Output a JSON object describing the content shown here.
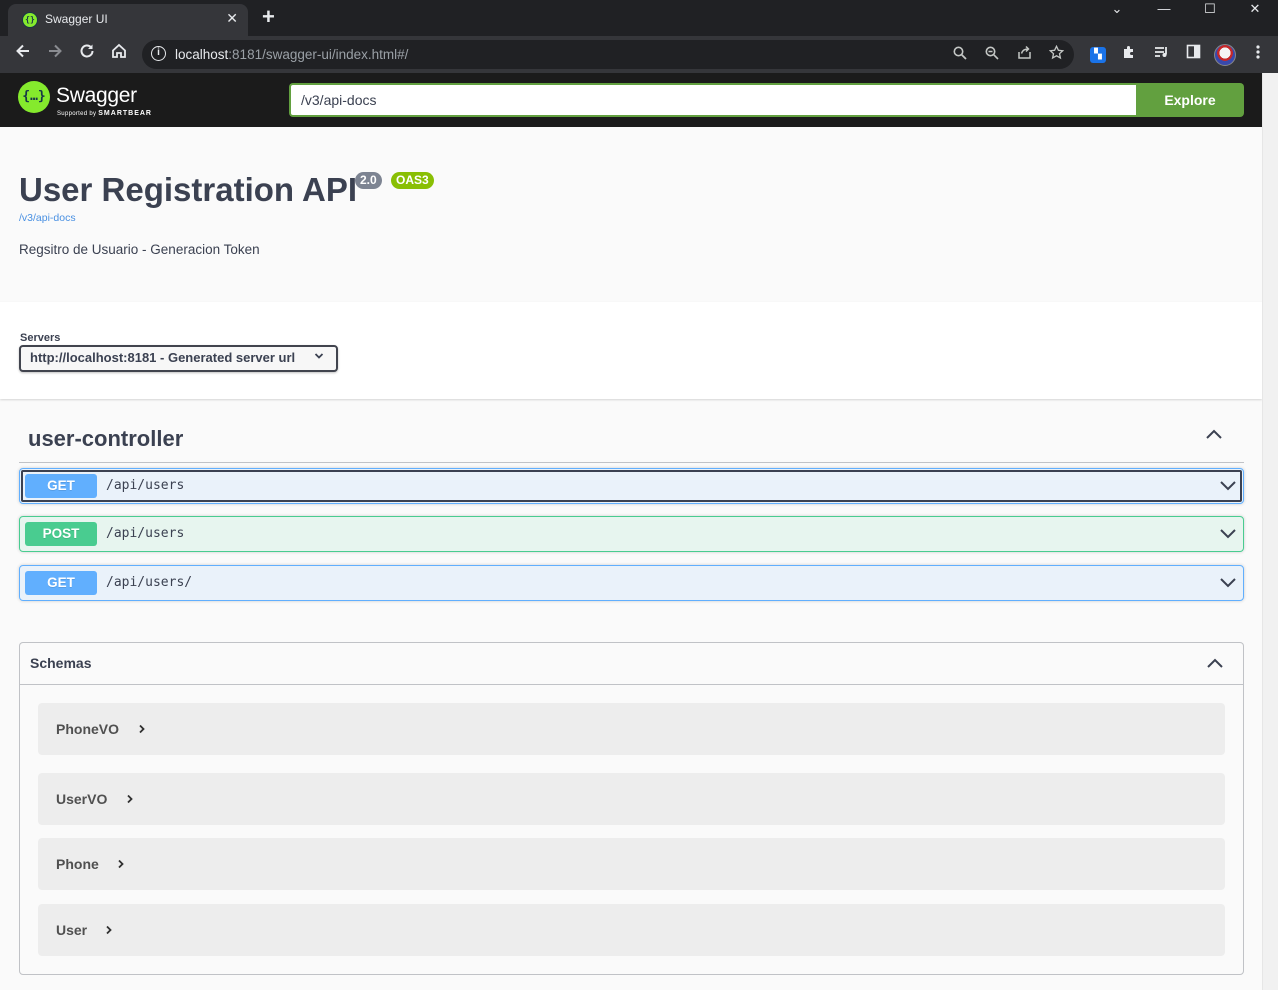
{
  "browser": {
    "tab_title": "Swagger UI",
    "tab_close": "✕",
    "new_tab": "+",
    "url_host": "localhost",
    "url_rest": ":8181/swagger-ui/index.html#/",
    "window_minimize": "—",
    "window_maximize": "☐",
    "window_close": "✕",
    "window_menu": "⌄"
  },
  "swagger": {
    "logo_glyph": "{…}",
    "brand": "Swagger",
    "brand_sub_prefix": "Supported by",
    "brand_sub_company": "SMARTBEAR",
    "spec_url": "/v3/api-docs",
    "explore_label": "Explore"
  },
  "info": {
    "title": "User Registration API",
    "version": "2.0",
    "oas": "OAS3",
    "spec_link": "/v3/api-docs",
    "description": "Regsitro de Usuario - Generacion Token"
  },
  "servers": {
    "label": "Servers",
    "selected": "http://localhost:8181 - Generated server url"
  },
  "tag": {
    "name": "user-controller"
  },
  "operations": [
    {
      "method": "GET",
      "path": "/api/users"
    },
    {
      "method": "POST",
      "path": "/api/users"
    },
    {
      "method": "GET",
      "path": "/api/users/"
    }
  ],
  "schemas": {
    "title": "Schemas",
    "models": [
      "PhoneVO",
      "UserVO",
      "Phone",
      "User"
    ]
  },
  "colors": {
    "get": "#61affe",
    "post": "#49cc90",
    "explore": "#62a03f",
    "swagger_green": "#85ea2d",
    "oas_badge": "#89bf04",
    "version_badge": "#7d8492"
  },
  "icons": {
    "back": "arrow-left-icon",
    "forward": "arrow-right-icon",
    "reload": "reload-icon",
    "home": "home-icon",
    "site_info": "info-icon",
    "search": "search-icon",
    "zoom": "zoom-out-icon",
    "share": "share-icon",
    "bookmark": "star-icon",
    "extensions": "puzzle-icon",
    "media": "media-controls-icon",
    "side_panel": "side-panel-icon",
    "menu": "kebab-menu-icon",
    "expand": "chevron-down-icon",
    "collapse": "chevron-up-icon",
    "model_expand": "chevron-right-icon"
  }
}
